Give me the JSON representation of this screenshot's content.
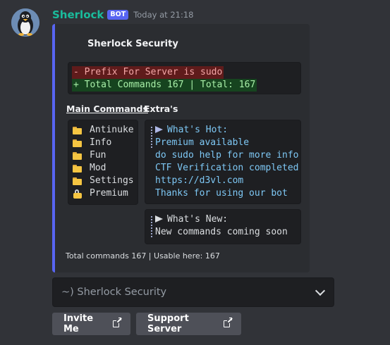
{
  "message": {
    "username": "Sherlock",
    "badge": "BOT",
    "timestamp": "Today at 21:18"
  },
  "colors": {
    "background": "#313338",
    "embed_background": "#2b2d31",
    "embed_accent": "#5865f2",
    "username": "#1abc9c",
    "badge": "#5865f2",
    "button": "#4e5058"
  },
  "embed": {
    "title": "Sherlock Security",
    "diff_block": [
      "- Prefix For Server is sudo",
      "+ Total Commands 167 | Total: 167"
    ],
    "main_commands": {
      "name": "Main Commands",
      "items": [
        {
          "icon": "folder-icon",
          "label": "Antinuke"
        },
        {
          "icon": "folder-icon",
          "label": "Info"
        },
        {
          "icon": "folder-icon",
          "label": "Fun"
        },
        {
          "icon": "folder-icon",
          "label": "Mod"
        },
        {
          "icon": "folder-icon",
          "label": "Settings"
        },
        {
          "icon": "unlocked-lock-icon",
          "label": "Premium"
        }
      ]
    },
    "extras": {
      "name": "Extra's",
      "hot": {
        "heading": "What's Hot:",
        "lines": [
          "Premium available",
          "do sudo help for more info",
          "CTF Verification completed",
          "https://d3vl.com",
          "Thanks for using our bot"
        ]
      },
      "new": {
        "heading": "What's New:",
        "lines": [
          "New commands coming soon"
        ]
      }
    },
    "footer": "Total commands 167 | Usable here: 167"
  },
  "select_menu": {
    "value": "~) Sherlock Security",
    "icon": "chevron-down-icon"
  },
  "buttons": {
    "invite": "Invite Me",
    "support": "Support Server",
    "icon": "external-link-icon"
  }
}
